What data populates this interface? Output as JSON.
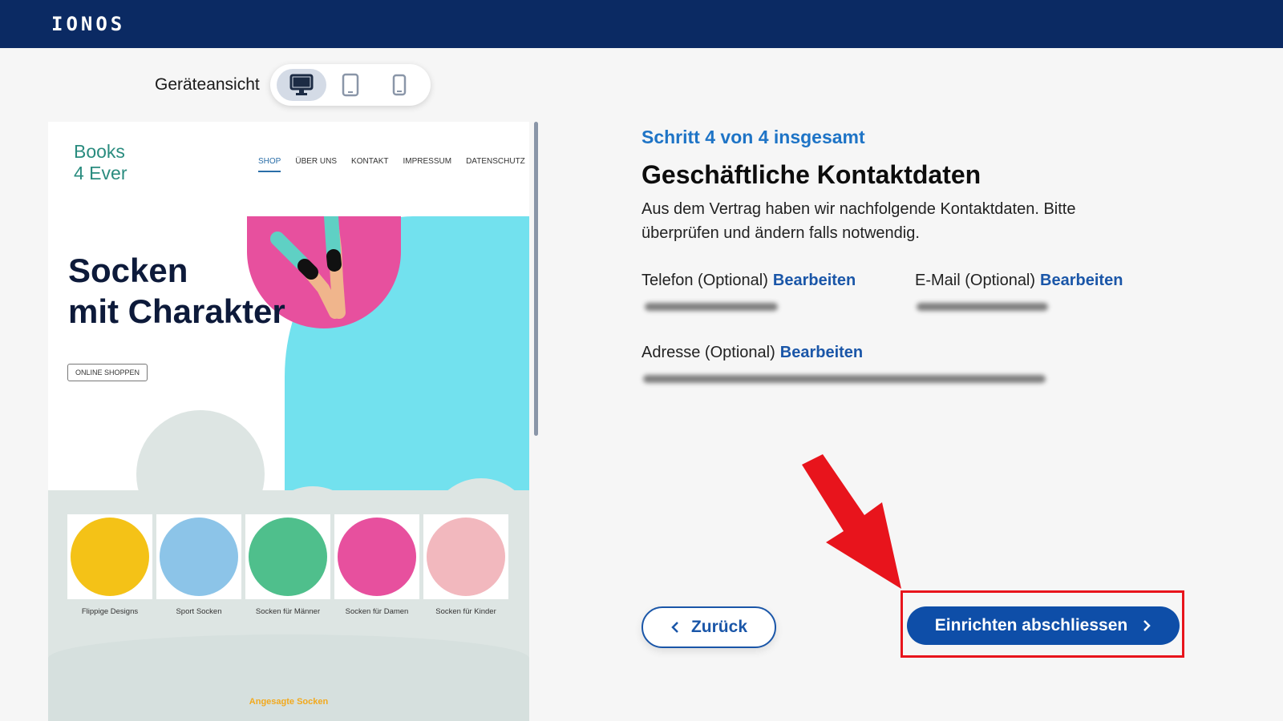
{
  "app": {
    "logo": "IONOS"
  },
  "device_view": {
    "label": "Geräteansicht",
    "options": [
      {
        "name": "desktop",
        "icon": "desktop-icon",
        "active": true
      },
      {
        "name": "tablet",
        "icon": "tablet-icon",
        "active": false
      },
      {
        "name": "mobile",
        "icon": "mobile-icon",
        "active": false
      }
    ]
  },
  "preview": {
    "site_logo": [
      "Books",
      "4 Ever"
    ],
    "nav": [
      "SHOP",
      "ÜBER UNS",
      "KONTAKT",
      "IMPRESSUM",
      "DATENSCHUTZ"
    ],
    "hero_title": [
      "Socken",
      "mit Charakter"
    ],
    "hero_button": "ONLINE SHOPPEN",
    "categories": [
      {
        "label": "Flippige Designs",
        "color": "#f4c217"
      },
      {
        "label": "Sport Socken",
        "color": "#8cc4e8"
      },
      {
        "label": "Socken für Männer",
        "color": "#4fbf8c"
      },
      {
        "label": "Socken für Damen",
        "color": "#e7509e"
      },
      {
        "label": "Socken für Kinder",
        "color": "#f2b8be"
      }
    ],
    "featured_heading": "Angesagte Socken"
  },
  "form": {
    "step": "Schritt 4 von 4 insgesamt",
    "title": "Geschäftliche Kontaktdaten",
    "description": "Aus dem Vertrag haben wir nachfolgende Kontaktdaten. Bitte überprüfen und ändern falls notwendig.",
    "phone_label": "Telefon (Optional)",
    "email_label": "E-Mail (Optional)",
    "address_label": "Adresse (Optional)",
    "edit_label": "Bearbeiten"
  },
  "actions": {
    "back": "Zurück",
    "finish": "Einrichten abschliessen"
  },
  "colors": {
    "header": "#0b2a63",
    "accent": "#1a56a8",
    "step": "#1e74c6",
    "highlight": "#e8141c"
  }
}
